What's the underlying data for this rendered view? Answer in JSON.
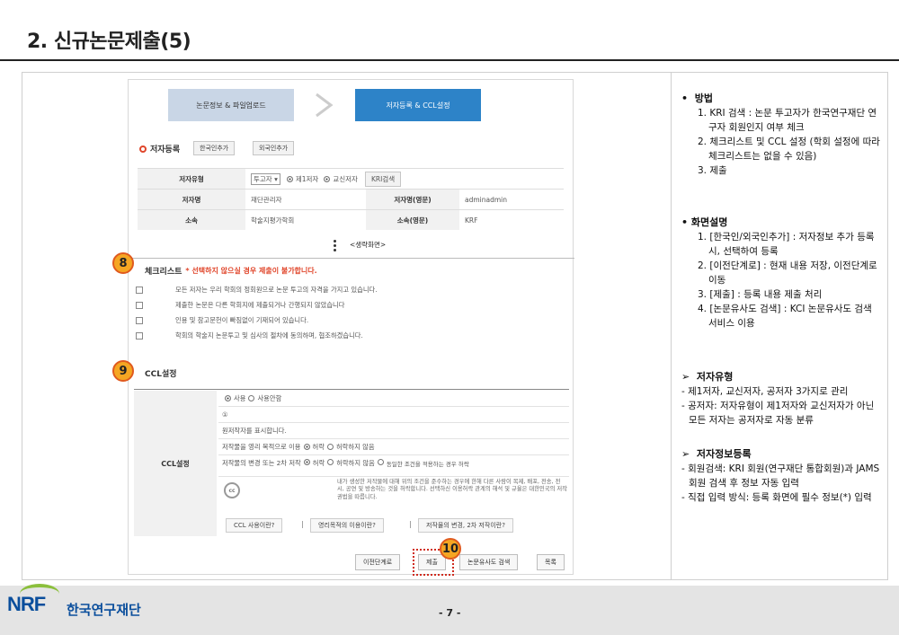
{
  "slide": {
    "title": "2. 신규논문제출(5)",
    "page_number": "- 7 -"
  },
  "steps": {
    "step1": "논문정보 & 파일업로드",
    "step2": "저자등록 & CCL설정"
  },
  "author": {
    "heading": "저자등록",
    "btn_kr": "한국인추가",
    "btn_foreign": "외국인추가",
    "rows": {
      "type_label": "저자유형",
      "type_select": "투고자",
      "first_author": "제1저자",
      "corresponding": "교신저자",
      "kri_btn": "KRI검색",
      "name_label": "저자명",
      "name_value": "재단관리자",
      "name_en_label": "저자명(영문)",
      "name_en_value": "adminadmin",
      "affil_label": "소속",
      "affil_value": "학술지평가학회",
      "affil_en_label": "소속(영문)",
      "affil_en_value": "KRF"
    }
  },
  "omitted": "<생략화면>",
  "checklist": {
    "badge": "8",
    "heading": "체크리스트",
    "warning": "* 선택하지 않으실 경우 제출이 불가합니다.",
    "items": [
      "모든 저자는 우리 학회의 정회원으로 논문 투고의 자격을 가지고 있습니다.",
      "제출한 논문은 다른 학회지에 제출되거나 간행되지 않았습니다",
      "인용 및 참고문헌이 빠짐없이 기재되어 있습니다.",
      "학회의 학술지 논문투고 및 심사의 절차에 동의하며, 협조하겠습니다."
    ]
  },
  "ccl": {
    "badge": "9",
    "heading": "CCL설정",
    "label": "CCL설정",
    "use": "사용",
    "not_use": "사용안함",
    "info_icon": "①",
    "attribution": "원저작자를 표시합니다.",
    "commercial_label": "저작물을 영리 목적으로 이용",
    "commercial_yes": "허락",
    "commercial_no": "허락하지 않음",
    "change_label": "저작물의 변경 또는 2차 저작",
    "change_yes": "허락",
    "change_no": "허락하지 않음",
    "change_same": "동일한 조건을 적용하는 경우 허락",
    "cc_icon": "cc",
    "desc": "내가 생성한 저작물에 대해 위의 조건을 준수하는 경우에 한해 다른 사람이 복제, 배포, 전송, 전시, 공연 및 방송하는 것을 허락합니다. 선택하신 이용허락 관계의 해석 및 규율은 대한민국의 저작권법을 따릅니다.",
    "btn_what": "CCL 사용이란?",
    "btn_commercial": "영리목적의 이용이란?",
    "btn_change": "저작물의 변경, 2차 저작이란?"
  },
  "bottom_buttons": {
    "badge": "10",
    "prev": "이전단계로",
    "submit": "제출",
    "similarity": "논문유사도 검색",
    "list": "목록"
  },
  "right_panel": {
    "method_head": "방법",
    "method_items": [
      "1. KRI 검색 : 논문 투고자가 한국연구재단 연구자 회원인지 여부 체크",
      "2. 체크리스트 및 CCL 설정 (학회 설정에 따라 체크리스트는 없을 수 있음)",
      "3. 제출"
    ],
    "screen_head": "화면설명",
    "screen_items": [
      "1. [한국인/외국인추가] : 저자정보 추가 등록 시, 선택하여 등록",
      "2. [이전단계로] : 현재 내용 저장, 이전단계로 이동",
      "3. [제출] : 등록 내용 제출 처리",
      "4. [논문유사도 검색] : KCI 논문유사도 검색 서비스 이용"
    ],
    "type_head": "저자유형",
    "type_items": [
      "- 제1저자, 교신저자, 공저자 3가지로 관리",
      "- 공저자: 저자유형이 제1저자와 교신저자가 아닌 모든 저자는 공저자로 자동 분류"
    ],
    "reg_head": "저자정보등록",
    "reg_items": [
      "- 회원검색: KRI 회원(연구재단 통합회원)과 JAMS 회원 검색 후 정보 자동 입력",
      "- 직접 입력 방식: 등록 화면에 필수 정보(*) 입력"
    ]
  },
  "footer": {
    "logo": "NRF",
    "org": "한국연구재단"
  },
  "colors": {
    "accent_blue": "#2d83c8",
    "warn_red": "#e0462b",
    "badge_orange": "#f5a623",
    "brand_blue": "#0a4e9c",
    "brand_green": "#8bbf3c"
  }
}
